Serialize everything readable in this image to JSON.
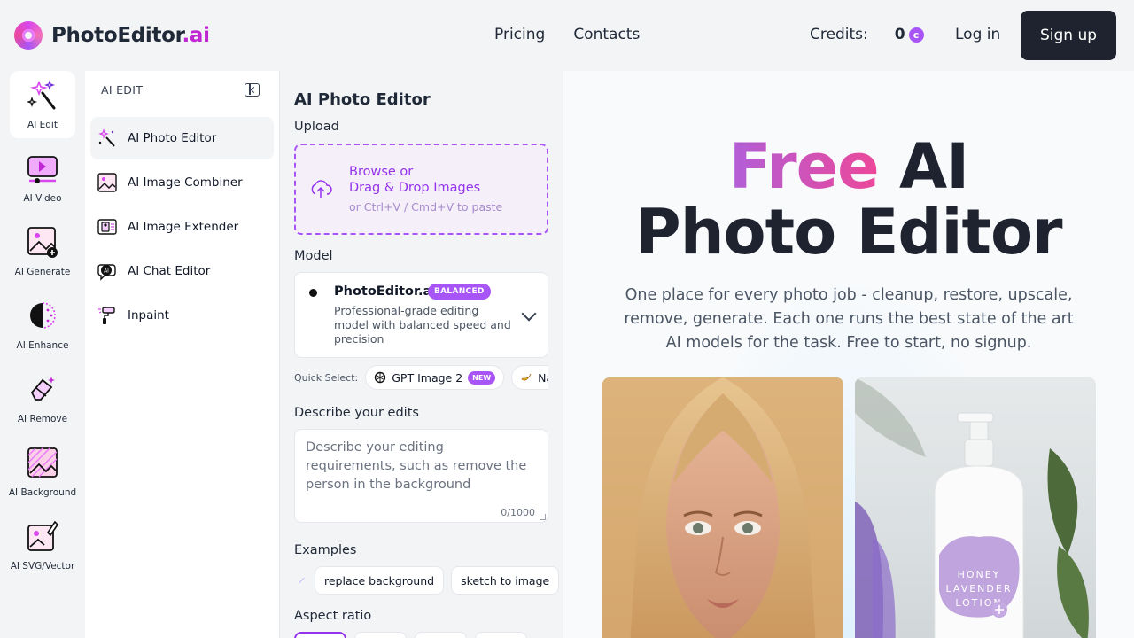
{
  "brand": {
    "name": "PhotoEditor",
    "suffix": ".ai"
  },
  "nav": {
    "links": [
      "Pricing",
      "Contacts"
    ],
    "credits_label": "Credits:",
    "credits_value": "0",
    "login": "Log in",
    "signup": "Sign up"
  },
  "rail": {
    "items": [
      {
        "label": "AI Edit",
        "active": true
      },
      {
        "label": "AI Video"
      },
      {
        "label": "AI Generate"
      },
      {
        "label": "AI Enhance"
      },
      {
        "label": "AI Remove"
      },
      {
        "label": "AI Background"
      },
      {
        "label": "AI SVG/Vector"
      }
    ]
  },
  "submenu": {
    "heading": "AI EDIT",
    "items": [
      {
        "label": "AI Photo Editor",
        "active": true
      },
      {
        "label": "AI Image Combiner"
      },
      {
        "label": "AI Image Extender"
      },
      {
        "label": "AI Chat Editor"
      },
      {
        "label": "Inpaint"
      }
    ]
  },
  "form": {
    "title": "AI Photo Editor",
    "upload_label": "Upload",
    "upload_line1": "Browse or",
    "upload_line2": "Drag & Drop Images",
    "upload_hint": "or Ctrl+V / Cmd+V to paste",
    "model_label": "Model",
    "model_name": "PhotoEditor.ai",
    "model_badge": "BALANCED",
    "model_desc": "Professional-grade editing model with balanced speed and precision",
    "quick_label": "Quick Select:",
    "quick_chips": [
      {
        "label": "GPT Image 2",
        "badge": "NEW"
      },
      {
        "label": "Nano"
      }
    ],
    "describe_label": "Describe your edits",
    "describe_placeholder": "Describe your editing requirements, such as remove the person in the background",
    "describe_count": "0/1000",
    "examples_label": "Examples",
    "examples": [
      "replace background",
      "sketch to image"
    ],
    "aspect_label": "Aspect ratio"
  },
  "hero": {
    "title_free": "Free",
    "title_rest": " AI",
    "title_line2": "Photo Editor",
    "subtitle": "One place for every photo job - cleanup, restore, upscale, remove, generate. Each one runs the best state of the art AI models for the task. Free to start, no signup.",
    "lotion_text": "HONEY LAVENDER LOTION"
  },
  "colors": {
    "accent": "#a855f7",
    "dark_button": "#1f2330",
    "brand_pink": "#c026d3"
  }
}
